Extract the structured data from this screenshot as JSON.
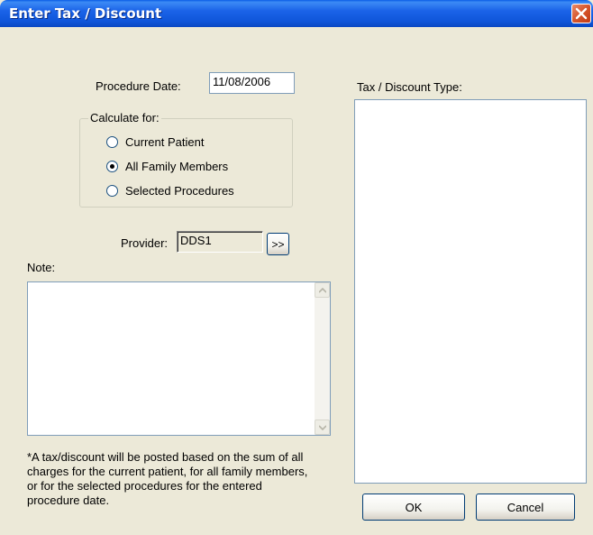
{
  "window": {
    "title": "Enter Tax / Discount"
  },
  "procedure_date": {
    "label": "Procedure Date:",
    "value": "11/08/2006"
  },
  "calculate_for": {
    "legend": "Calculate for:",
    "options": [
      {
        "label": "Current Patient",
        "checked": false
      },
      {
        "label": "All Family Members",
        "checked": true
      },
      {
        "label": "Selected Procedures",
        "checked": false
      }
    ]
  },
  "provider": {
    "label": "Provider:",
    "value": "DDS1",
    "browse_label": ">>"
  },
  "note": {
    "label": "Note:",
    "value": ""
  },
  "tax_discount_type": {
    "label": "Tax / Discount Type:"
  },
  "footnote": "*A tax/discount will be posted based on the sum of all charges for the current patient, for all family members, or for the selected procedures for the entered procedure date.",
  "buttons": {
    "ok": "OK",
    "cancel": "Cancel"
  },
  "icons": {
    "close": "close-icon",
    "scroll_up": "scroll-up-arrow-icon",
    "scroll_down": "scroll-down-arrow-icon"
  }
}
